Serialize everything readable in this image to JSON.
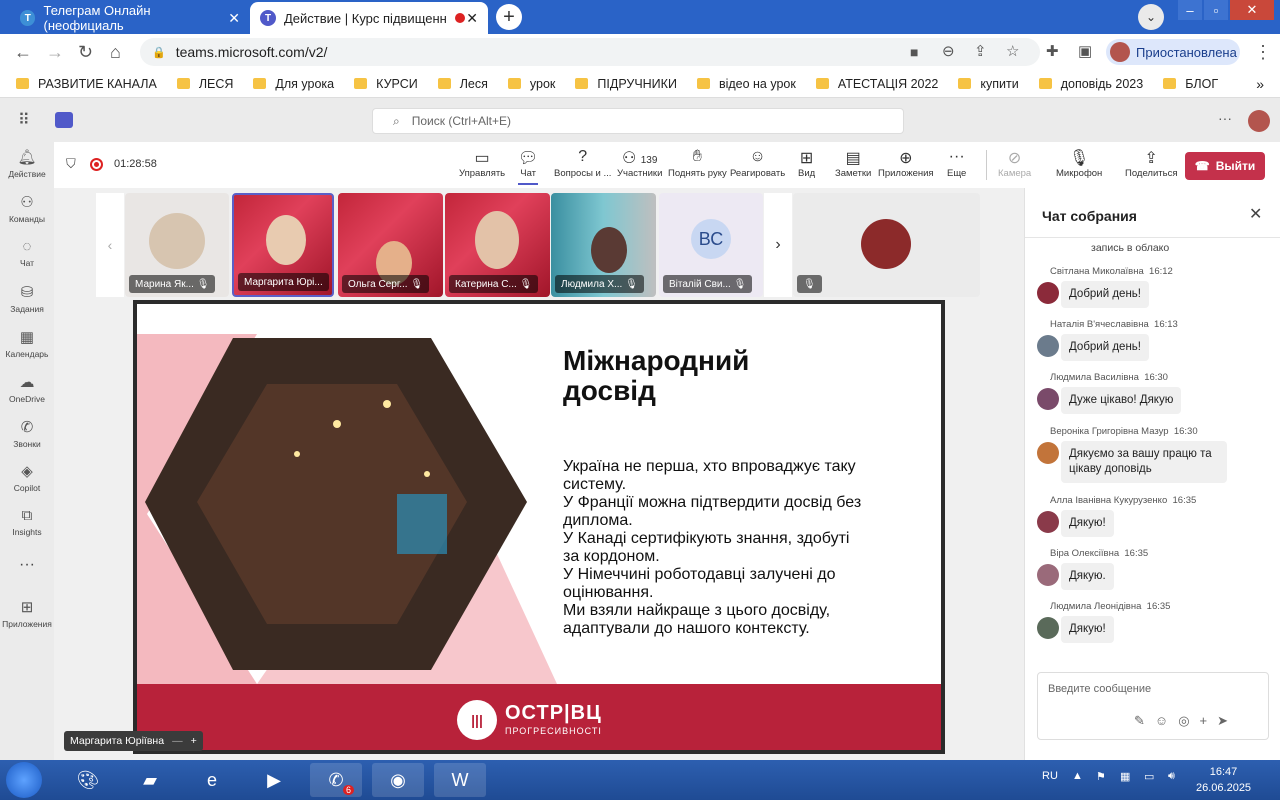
{
  "browser": {
    "tabs": [
      {
        "title": "Телеграм Онлайн (неофициаль",
        "active": false
      },
      {
        "title": "Действие | Курс підвищенн",
        "active": true
      }
    ],
    "url": "teams.microsoft.com/v2/",
    "profile_label": "Приостановлена",
    "bookmarks": [
      "РАЗВИТИЕ КАНАЛА",
      "ЛЕСЯ",
      "Для урока",
      "КУРСИ",
      "Леся",
      "урок",
      "ПІДРУЧНИКИ",
      "відео на урок",
      "АТЕСТАЦІЯ 2022",
      "купити",
      "доповідь 2023",
      "БЛОГ"
    ]
  },
  "teams": {
    "search_placeholder": "Поиск (Ctrl+Alt+E)",
    "rail": [
      "Действие",
      "Команды",
      "Чат",
      "Задания",
      "Календарь",
      "OneDrive",
      "Звонки",
      "Copilot",
      "Insights",
      "Приложения"
    ],
    "timer": "01:28:58",
    "toolbar": {
      "manage": "Управлять",
      "chat": "Чат",
      "qa": "Вопросы и ...",
      "participants_count": "139",
      "participants": "Участники",
      "raise_hand": "Поднять руку",
      "react": "Реагировать",
      "view": "Вид",
      "notes": "Заметки",
      "apps": "Приложения",
      "more": "Еще",
      "camera": "Камера",
      "mic": "Микрофон",
      "share": "Поделиться",
      "leave": "Выйти"
    },
    "participants": [
      {
        "name": "Марина Як..."
      },
      {
        "name": "Маргарита Юрі..."
      },
      {
        "name": "Ольга Серг..."
      },
      {
        "name": "Катерина С..."
      },
      {
        "name": "Людмила Х..."
      },
      {
        "name": "Віталій Сви...",
        "initials": "ВС"
      }
    ],
    "presenter_label": "Маргарита Юріївна"
  },
  "slide": {
    "title_line1": "Міжнародний",
    "title_line2": "досвід",
    "body_lines": [
      "Україна не перша, хто впроваджує таку",
      "систему.",
      "У Франції можна підтвердити досвід без",
      "диплома.",
      "У Канаді сертифікують знання, здобуті",
      "за кордоном.",
      "У Німеччині роботодавці залучені до",
      "оцінювання.",
      "Ми взяли найкраще з цього досвіду,",
      "адаптували до нашого контексту."
    ],
    "logo_text": "ОСТР|ВЦ",
    "logo_sub": "ПРОГРЕСИВНОСТІ"
  },
  "chat": {
    "title": "Чат собрания",
    "first_partial": "запись в облако",
    "messages": [
      {
        "author": "Світлана Миколаївна",
        "time": "16:12",
        "text": "Добрий день!",
        "color": "#8b2a3a"
      },
      {
        "author": "Наталія В'ячеславівна",
        "time": "16:13",
        "text": "Добрий день!",
        "color": "#6b7b8c"
      },
      {
        "author": "Людмила Василівна",
        "time": "16:30",
        "text": "Дуже цікаво! Дякую",
        "color": "#7a4a6a"
      },
      {
        "author": "Вероніка Григорівна Мазур",
        "time": "16:30",
        "text": "Дякуємо за вашу працю та цікаву доповідь",
        "color": "#c2743a"
      },
      {
        "author": "Алла Іванівна Кукурузенко",
        "time": "16:35",
        "text": "Дякую!",
        "color": "#8a3a4a"
      },
      {
        "author": "Віра Олексіївна",
        "time": "16:35",
        "text": "Дякую.",
        "color": "#9a6a7a"
      },
      {
        "author": "Людмила Леонідівна",
        "time": "16:35",
        "text": "Дякую!",
        "color": "#5a6a5a"
      }
    ],
    "composer_placeholder": "Введите сообщение"
  },
  "taskbar": {
    "lang": "RU",
    "time": "16:47",
    "date": "26.06.2025",
    "viber_badge": "6"
  }
}
